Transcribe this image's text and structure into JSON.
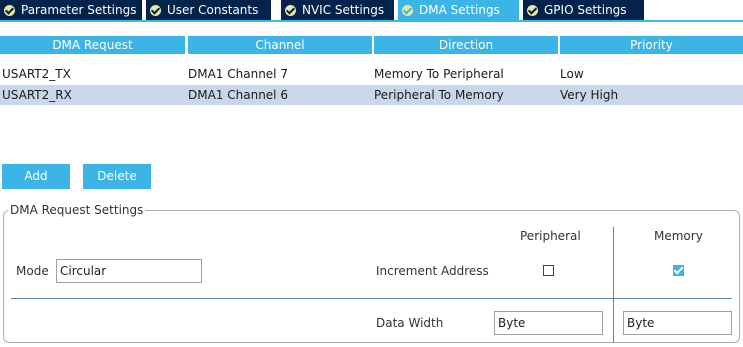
{
  "tabs": [
    {
      "label": "Parameter Settings",
      "active": false
    },
    {
      "label": "User Constants",
      "active": false
    },
    {
      "label": "NVIC Settings",
      "active": false
    },
    {
      "label": "DMA Settings",
      "active": true
    },
    {
      "label": "GPIO Settings",
      "active": false
    }
  ],
  "table": {
    "columns": [
      "DMA Request",
      "Channel",
      "Direction",
      "Priority"
    ],
    "rows": [
      [
        "USART2_TX",
        "DMA1 Channel 7",
        "Memory To Peripheral",
        "Low"
      ],
      [
        "USART2_RX",
        "DMA1 Channel 6",
        "Peripheral To Memory",
        "Very High"
      ]
    ],
    "selected_row": 1
  },
  "buttons": {
    "add": "Add",
    "delete": "Delete"
  },
  "settings": {
    "title": "DMA Request Settings",
    "peripheral_header": "Peripheral",
    "memory_header": "Memory",
    "mode_label": "Mode",
    "mode_value": "Circular",
    "increment_label": "Increment Address",
    "increment_peripheral": false,
    "increment_memory": true,
    "data_width_label": "Data Width",
    "data_width_peripheral": "Byte",
    "data_width_memory": "Byte"
  },
  "colors": {
    "tab_bg": "#03234b",
    "accent": "#3cb4e6",
    "selected_row": "#c8d8ea"
  }
}
